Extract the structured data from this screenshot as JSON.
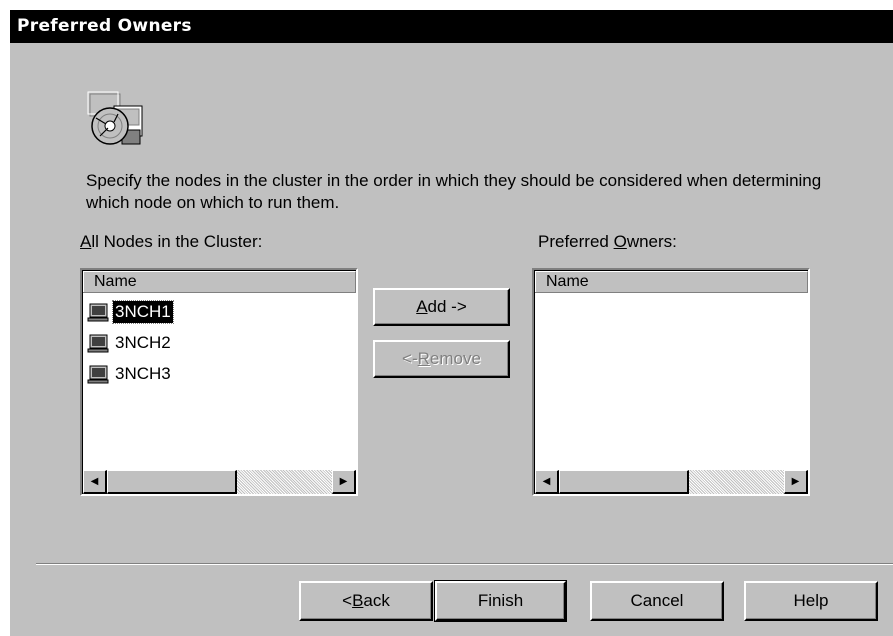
{
  "window": {
    "title": "Preferred  Owners"
  },
  "description": "Specify  the nodes  in the cluster in the  order in which they should be considered when determining which node on which to run them.",
  "all_nodes": {
    "label_prefix": "",
    "label_mnemonic": "A",
    "label_rest": "ll Nodes in the Cluster:",
    "column": "Name",
    "items": [
      {
        "label": "3NCH1",
        "selected": true
      },
      {
        "label": "3NCH2",
        "selected": false
      },
      {
        "label": "3NCH3",
        "selected": false
      }
    ]
  },
  "preferred_owners": {
    "label_prefix": "Preferred  ",
    "label_mnemonic": "O",
    "label_rest": "wners:",
    "column": "Name",
    "items": []
  },
  "buttons": {
    "add": {
      "mnemonic": "A",
      "rest": "dd ->"
    },
    "remove": {
      "prefix": "<- ",
      "mnemonic": "R",
      "rest": "emove",
      "disabled": true
    },
    "back": {
      "prefix": "< ",
      "mnemonic": "B",
      "rest": "ack"
    },
    "finish": "Finish",
    "cancel": "Cancel",
    "help": "Help"
  },
  "icons": {
    "wizard": "cluster-disk-icon",
    "node": "computer-node-icon",
    "scroll_left": "arrow-left-icon",
    "scroll_right": "arrow-right-icon"
  },
  "colors": {
    "title_bg": "#000000",
    "face": "#c0c0c0",
    "selection": "#000000"
  }
}
